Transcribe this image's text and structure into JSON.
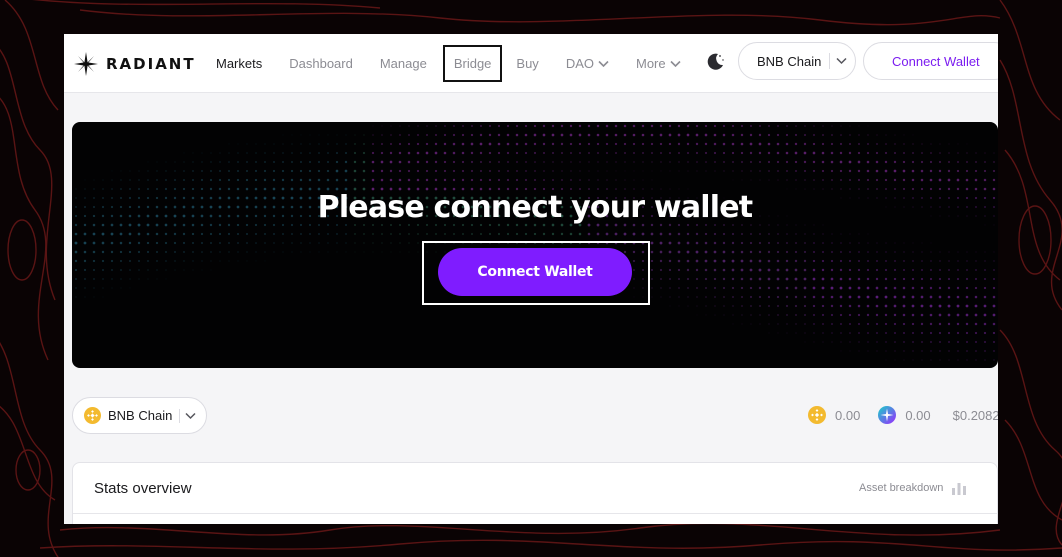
{
  "app": {
    "logo_text": "RADIANT"
  },
  "nav": {
    "items": [
      {
        "label": "Markets"
      },
      {
        "label": "Dashboard"
      },
      {
        "label": "Manage"
      },
      {
        "label": "Bridge"
      },
      {
        "label": "Buy"
      },
      {
        "label": "DAO"
      },
      {
        "label": "More"
      }
    ]
  },
  "header": {
    "chain_label": "BNB Chain",
    "connect_label": "Connect Wallet"
  },
  "hero": {
    "title": "Please connect your wallet",
    "button_label": "Connect Wallet"
  },
  "toolbar": {
    "chain_label": "BNB Chain",
    "balances": [
      {
        "icon": "bnb-token-icon",
        "value": "0.00"
      },
      {
        "icon": "rdnt-token-icon",
        "value": "0.00"
      }
    ],
    "price": "$0.2082"
  },
  "stats": {
    "title": "Stats overview",
    "link_label": "Asset breakdown"
  },
  "colors": {
    "accent": "#7f1cff",
    "accent_text": "#7b1cf0",
    "bnb": "#f3ba2f"
  }
}
